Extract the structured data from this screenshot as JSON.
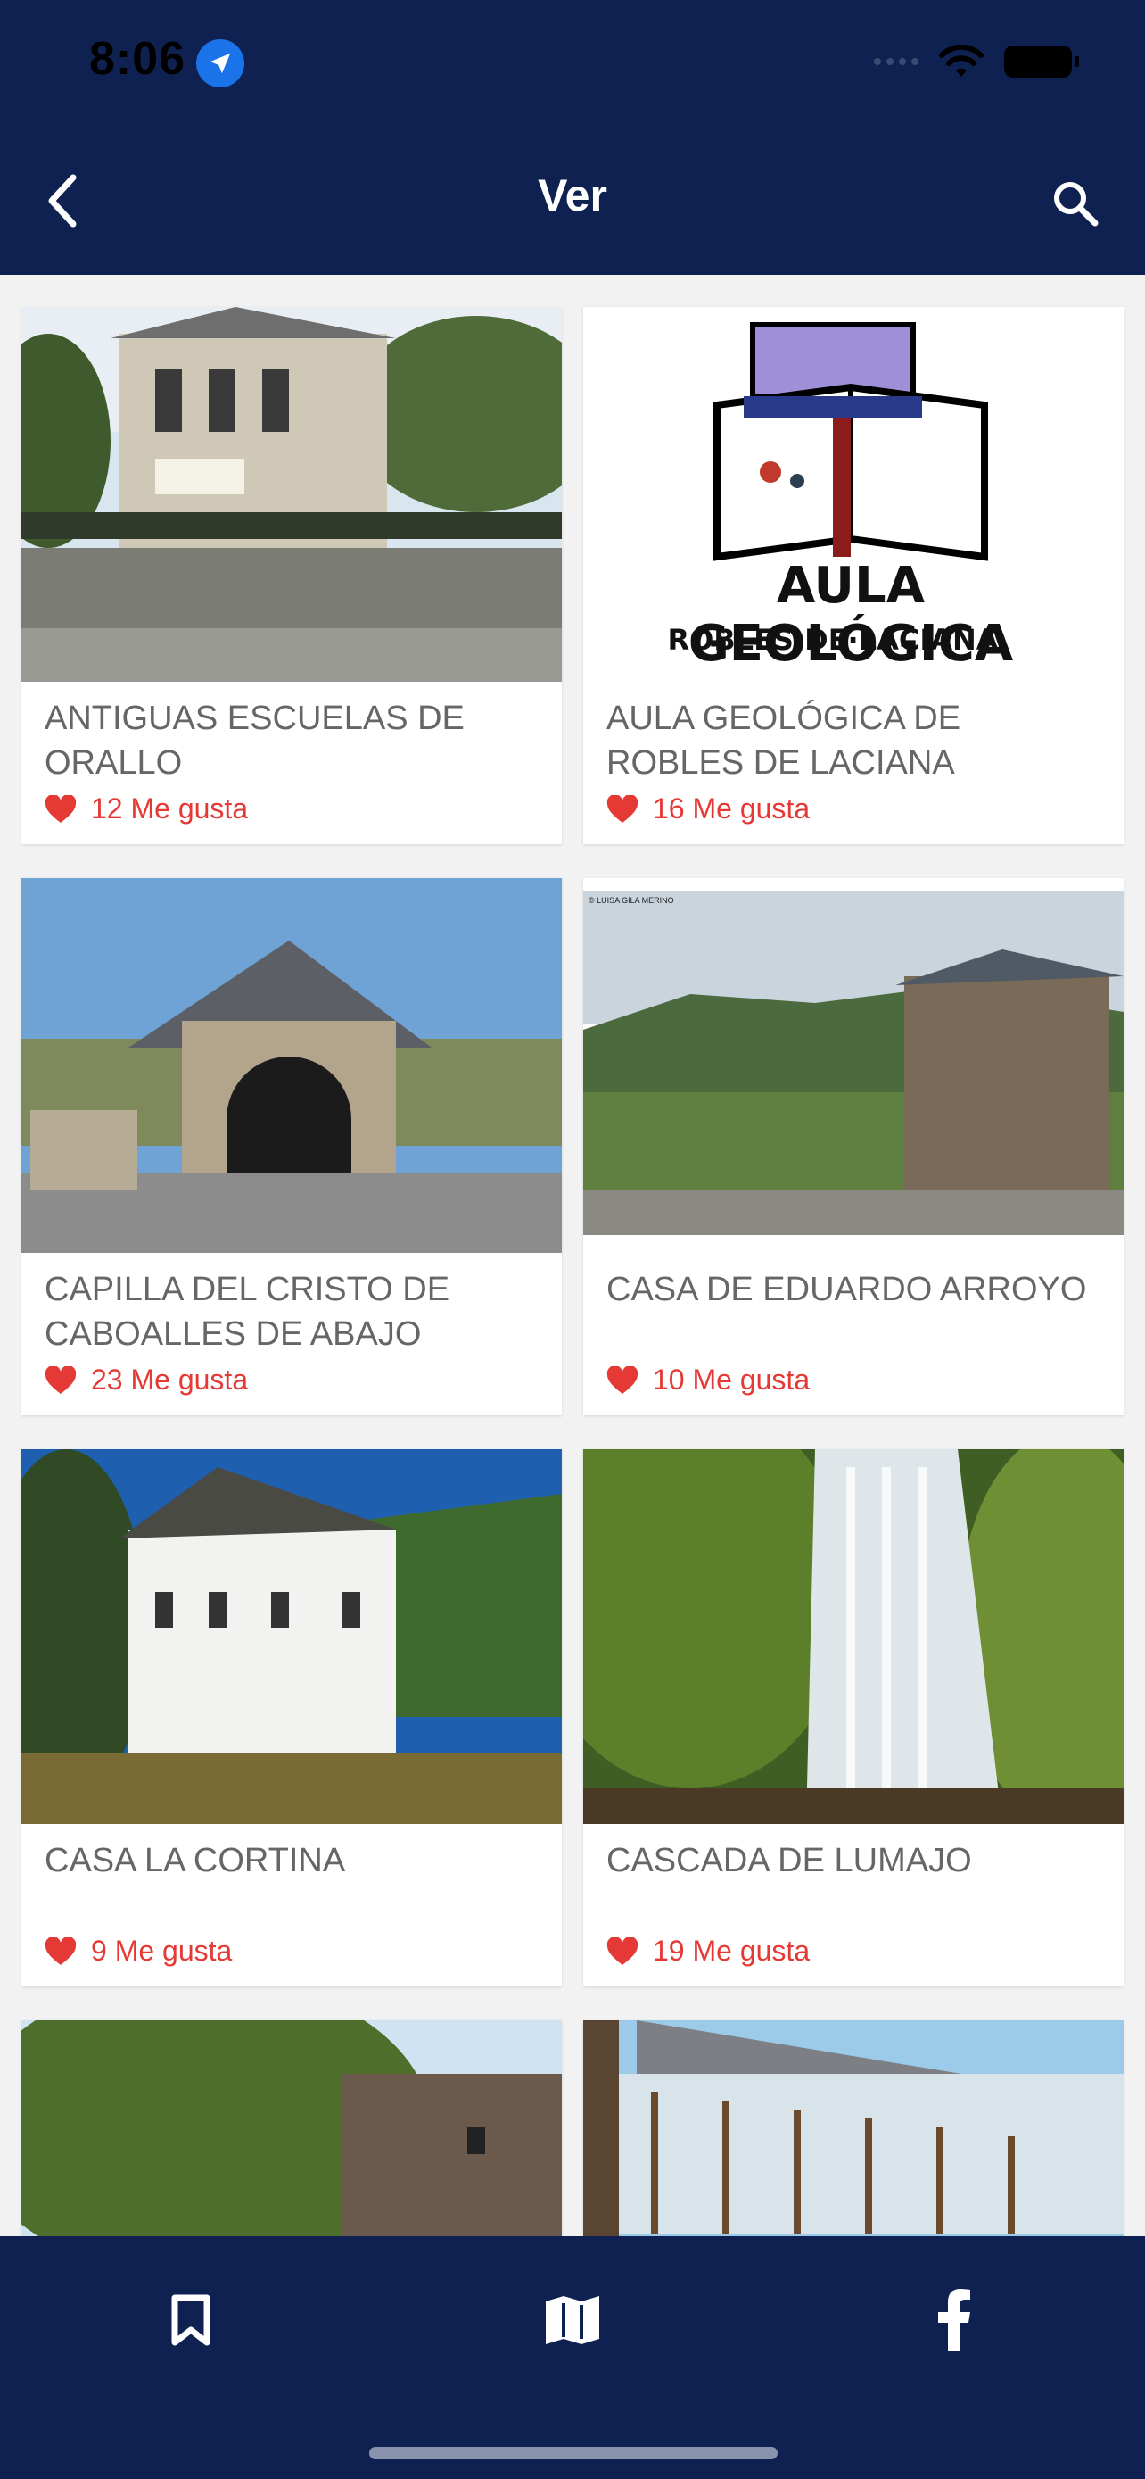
{
  "status_bar": {
    "time": "8:06"
  },
  "header": {
    "title": "Ver"
  },
  "cards": [
    {
      "title": "ANTIGUAS ESCUELAS DE ORALLO",
      "likes": "12 Me gusta"
    },
    {
      "title": "AULA GEOLÓGICA DE ROBLES DE LACIANA",
      "likes": "16 Me gusta",
      "logo_text_top": "AULA GEOLÓGICA",
      "logo_text_bottom": "ROBLES·DE·LACIANA"
    },
    {
      "title": "CAPILLA DEL CRISTO DE CABOALLES DE ABAJO",
      "likes": "23 Me gusta"
    },
    {
      "title": "CASA DE EDUARDO ARROYO",
      "likes": "10 Me gusta",
      "watermark": "© LUISA GILA MERINO"
    },
    {
      "title": "CASA LA CORTINA",
      "likes": "9 Me gusta"
    },
    {
      "title": "CASCADA DE LUMAJO",
      "likes": "19 Me gusta"
    }
  ],
  "colors": {
    "header_bg": "#0f2150",
    "like": "#e53935",
    "title_text": "#666666"
  },
  "icons": {
    "back": "chevron-left-icon",
    "search": "search-icon",
    "bookmark": "bookmark-icon",
    "map": "map-icon",
    "facebook": "facebook-icon"
  }
}
